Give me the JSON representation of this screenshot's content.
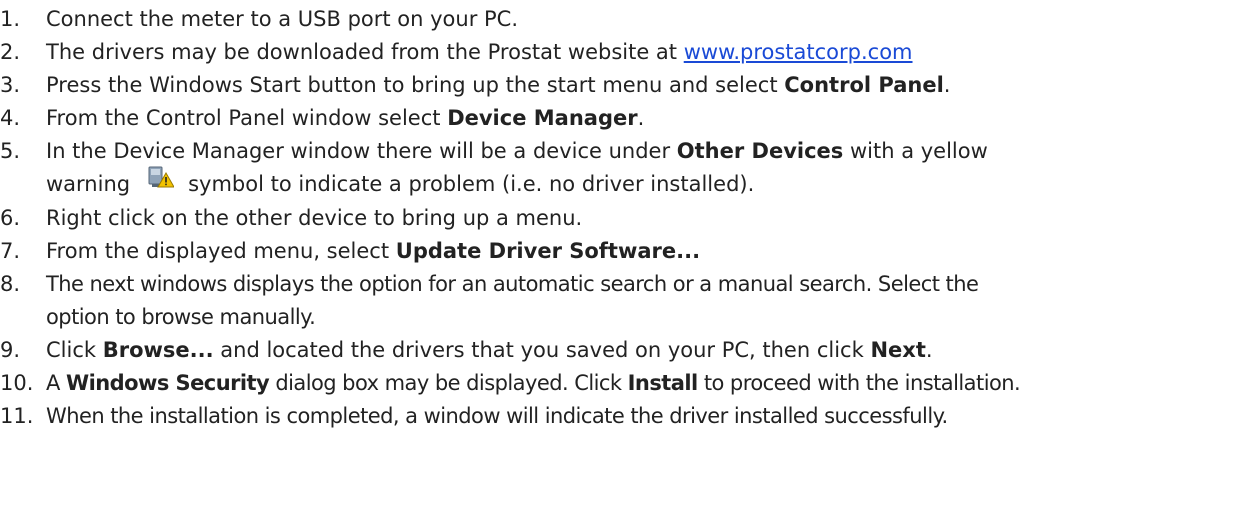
{
  "steps": [
    {
      "num": "1.",
      "text": "Connect the meter to a USB port on your PC."
    },
    {
      "num": "2.",
      "pre": "The drivers may be downloaded from the Prostat website at ",
      "link": "www.prostatcorp.com"
    },
    {
      "num": "3.",
      "pre": "Press the Windows Start button to bring up the start menu and select ",
      "bold": "Control Panel",
      "post": "."
    },
    {
      "num": "4.",
      "pre": "From the Control Panel window select ",
      "bold": "Device Manager",
      "post": "."
    },
    {
      "num": "5.",
      "pre": "In the Device Manager window there will be a device under ",
      "bold": "Other Devices",
      "mid": " with a yellow",
      "line2_pre": "warning",
      "icon": "warning-device-icon",
      "line2_post": "symbol to indicate a problem (i.e. no driver installed)."
    },
    {
      "num": "6.",
      "text": "Right click on the other device to bring up a menu."
    },
    {
      "num": "7.",
      "pre": "From the displayed menu, select ",
      "bold": "Update Driver Software..."
    },
    {
      "num": "8.",
      "line1": "The next windows displays the option for an automatic search or a manual search. Select the",
      "line2": "option to browse manually."
    },
    {
      "num": "9.",
      "pre": "Click ",
      "bold": "Browse...",
      "mid": " and located the drivers that you saved on your PC, then click ",
      "bold2": "Next",
      "post": "."
    },
    {
      "num": "10.",
      "pre": "A ",
      "bold": "Windows Security",
      "mid": " dialog box may be displayed. Click ",
      "bold2": "Install",
      "post": " to proceed with the installation."
    },
    {
      "num": "11.",
      "text": "When the installation is completed, a window will indicate the driver installed successfully."
    }
  ]
}
